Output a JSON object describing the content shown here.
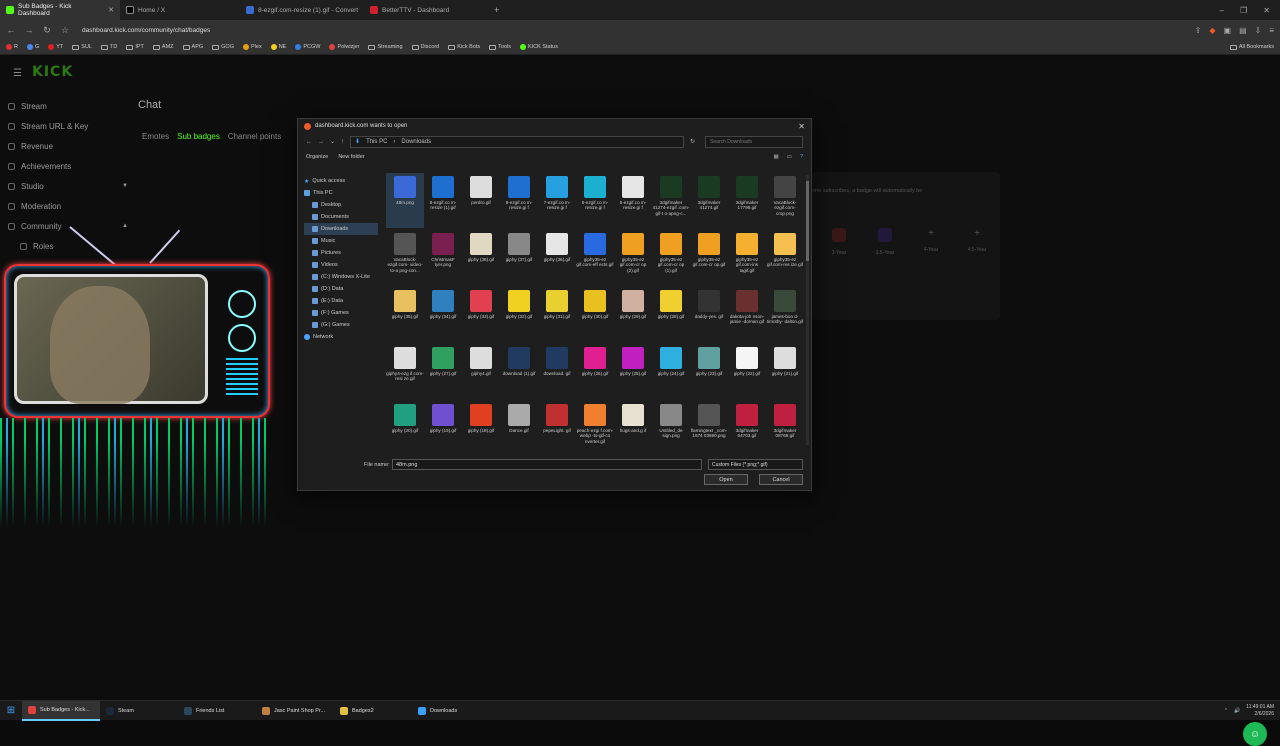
{
  "browser": {
    "tabs": [
      {
        "label": "Sub Badges - Kick Dashboard",
        "active": true
      },
      {
        "label": "Home / X",
        "active": false
      },
      {
        "label": "8-ezgif.com-resize (1).gif - Convert G",
        "active": false
      },
      {
        "label": "BetterTTV - Dashboard",
        "active": false
      }
    ],
    "url": "dashboard.kick.com/community/chat/badges",
    "bookmarks": [
      "R",
      "G",
      "YT",
      "SUL",
      "TD",
      "IPT",
      "AMZ",
      "APG",
      "GOG",
      "Plex",
      "NE",
      "PCGW",
      "Polwizjer",
      "Streaming",
      "Discord",
      "Kick Bots",
      "Tools",
      "KICK Status"
    ],
    "all_bookmarks": "All Bookmarks"
  },
  "kick": {
    "logo": "KICK",
    "sidebar": [
      {
        "label": "Stream",
        "icon": "broadcast-icon"
      },
      {
        "label": "Stream URL & Key",
        "icon": "key-icon"
      },
      {
        "label": "Revenue",
        "icon": "revenue-icon"
      },
      {
        "label": "Achievements",
        "icon": "trophy-icon"
      },
      {
        "label": "Studio",
        "icon": "studio-icon",
        "chevron": true
      },
      {
        "label": "Moderation",
        "icon": "shield-icon"
      },
      {
        "label": "Community",
        "icon": "community-icon",
        "chevron": true
      },
      {
        "label": "Roles",
        "icon": "roles-icon"
      }
    ],
    "page_title": "Chat",
    "tabs": [
      "Emotes",
      "Sub badges",
      "Channel points"
    ],
    "active_tab": "Sub badges",
    "hint": "one subscribes, a badge will automatically be",
    "badge_slots": [
      "3-Year",
      "3.5-Year",
      "4-Year",
      "4.5-Year"
    ]
  },
  "dialog": {
    "title": "dashboard.kick.com wants to open",
    "breadcrumb": [
      "This PC",
      "Downloads"
    ],
    "search_placeholder": "Search Downloads",
    "organize": "Organize",
    "new_folder": "New folder",
    "tree": [
      {
        "label": "Quick access",
        "kind": "star"
      },
      {
        "label": "This PC",
        "kind": "pc"
      },
      {
        "label": "Desktop"
      },
      {
        "label": "Documents"
      },
      {
        "label": "Downloads",
        "selected": true
      },
      {
        "label": "Music"
      },
      {
        "label": "Pictures"
      },
      {
        "label": "Videos"
      },
      {
        "label": "(C:) Windows X-Lite"
      },
      {
        "label": "(D:) Data"
      },
      {
        "label": "(E:) Data"
      },
      {
        "label": "(F:) Games"
      },
      {
        "label": "(G:) Games"
      },
      {
        "label": "Network",
        "kind": "net"
      }
    ],
    "files": [
      {
        "name": "48m.png",
        "color": "#3b6ad8",
        "selected": true
      },
      {
        "name": "8-ezgif.co m-resize (1).gif",
        "color": "#1f6fd1"
      },
      {
        "name": "perdro.gif",
        "color": "#ddd"
      },
      {
        "name": "8-ezgif.co m-resize.gi f",
        "color": "#1f6fd1"
      },
      {
        "name": "7-ezgif.co m-resize.gi f",
        "color": "#27a0e0"
      },
      {
        "name": "6-ezgif.co m-resize.gi f",
        "color": "#1bb0d0"
      },
      {
        "name": "5-ezgif.co m-resize.gi f",
        "color": "#e6e6e6"
      },
      {
        "name": "3dgifmaker 41274-ezgif .com-gif-t o-apng-c...",
        "color": "#1a3a22"
      },
      {
        "name": "3dgifmaker 41274.gif",
        "color": "#1a3a22"
      },
      {
        "name": "3dgifmaker 17799.gif",
        "color": "#1a3a22"
      },
      {
        "name": "VacaBlock- ezgif.com- crop.png",
        "color": "#444"
      },
      {
        "name": "VacaBlock- ezgif.com- video-to-a png-con...",
        "color": "#555"
      },
      {
        "name": "ChristmasF lyer.png",
        "color": "#7a2050"
      },
      {
        "name": "giphy (38).gif",
        "color": "#e0d8c0"
      },
      {
        "name": "giphy (37).gif",
        "color": "#888"
      },
      {
        "name": "giphy (36).gif",
        "color": "#e6e6e6"
      },
      {
        "name": "giphy35-ez gif.com-eff ects.gif",
        "color": "#2a6ae0"
      },
      {
        "name": "giphy35-ez gif.com-cr op (2).gif",
        "color": "#f0a020"
      },
      {
        "name": "giphy35-ez gif.com-cr op (1).gif",
        "color": "#f0a020"
      },
      {
        "name": "giphy35-ez gif.com-cr op.gif",
        "color": "#f0a020"
      },
      {
        "name": "giphy35-ez gif.com-ins tagif.gif",
        "color": "#f5b030"
      },
      {
        "name": "giphy35-ez gif.com-res ize.gif",
        "color": "#f5c050"
      },
      {
        "name": "giphy (35).gif",
        "color": "#e8c060"
      },
      {
        "name": "giphy (34).gif",
        "color": "#3080c0"
      },
      {
        "name": "giphy (33).gif",
        "color": "#e04050"
      },
      {
        "name": "giphy (32).gif",
        "color": "#f0d020"
      },
      {
        "name": "giphy (31).gif",
        "color": "#e8d030"
      },
      {
        "name": "giphy (30).gif",
        "color": "#e8c020"
      },
      {
        "name": "giphy (29).gif",
        "color": "#d0b0a0"
      },
      {
        "name": "giphy (28).gif",
        "color": "#f0d030"
      },
      {
        "name": "daddy-yes. gif",
        "color": "#333"
      },
      {
        "name": "dakota-joh nson-jamie -dornan.gif",
        "color": "#6a3030"
      },
      {
        "name": "james-bon d-timothy- dalton.gif",
        "color": "#3a4a3a"
      },
      {
        "name": "giphy4-ezg if.com-resi ze.gif",
        "color": "#ddd"
      },
      {
        "name": "giphy (27).gif",
        "color": "#30a060"
      },
      {
        "name": "giphy4.gif",
        "color": "#ddd"
      },
      {
        "name": "download (1).gif",
        "color": "#203a60"
      },
      {
        "name": "download. gif",
        "color": "#203a60"
      },
      {
        "name": "giphy (26).gif",
        "color": "#e02090"
      },
      {
        "name": "giphy (25).gif",
        "color": "#c020c0"
      },
      {
        "name": "giphy (24).gif",
        "color": "#30b0e0"
      },
      {
        "name": "giphy (23).gif",
        "color": "#60a0a0"
      },
      {
        "name": "giphy (22).gif",
        "color": "#f5f5f5"
      },
      {
        "name": "giphy (21).gif",
        "color": "#ddd"
      },
      {
        "name": "giphy (20).gif",
        "color": "#20a080"
      },
      {
        "name": "giphy (19).gif",
        "color": "#7050d0"
      },
      {
        "name": "giphy (18).gif",
        "color": "#e04020"
      },
      {
        "name": "Dance.gif",
        "color": "#aaa"
      },
      {
        "name": "pepeLight. gif",
        "color": "#c03030"
      },
      {
        "name": "peach-ezgi f.com-webp -to-gif-co nverter.gif",
        "color": "#f08030"
      },
      {
        "name": "hugs-and.g if",
        "color": "#e8e0d0"
      },
      {
        "name": "Untitled_de sign.png",
        "color": "#888"
      },
      {
        "name": "flamingtext _com-1674 03590.png",
        "color": "#555"
      },
      {
        "name": "3dgifmaker 54703.gif",
        "color": "#c02040"
      },
      {
        "name": "3dgifmaker 08769.gif",
        "color": "#c02040"
      }
    ],
    "filename_label": "File name:",
    "filename_value": "48m.png",
    "filetype": "Custom Files (*.png;*.gif)",
    "open_label": "Open",
    "cancel_label": "Cancel"
  },
  "taskbar": {
    "items": [
      {
        "label": "Sub Badges - Kick...",
        "color": "#e04040",
        "active": true
      },
      {
        "label": "Steam",
        "color": "#1b2838"
      },
      {
        "label": "Friends List",
        "color": "#2a475e"
      },
      {
        "label": "Jasc Paint Shop Pr...",
        "color": "#c08040"
      },
      {
        "label": "Badges2",
        "color": "#e0c040"
      },
      {
        "label": "Downloads",
        "color": "#3aa0ff"
      }
    ],
    "time": "11:49:01 AM",
    "date": "2/6/2026"
  }
}
